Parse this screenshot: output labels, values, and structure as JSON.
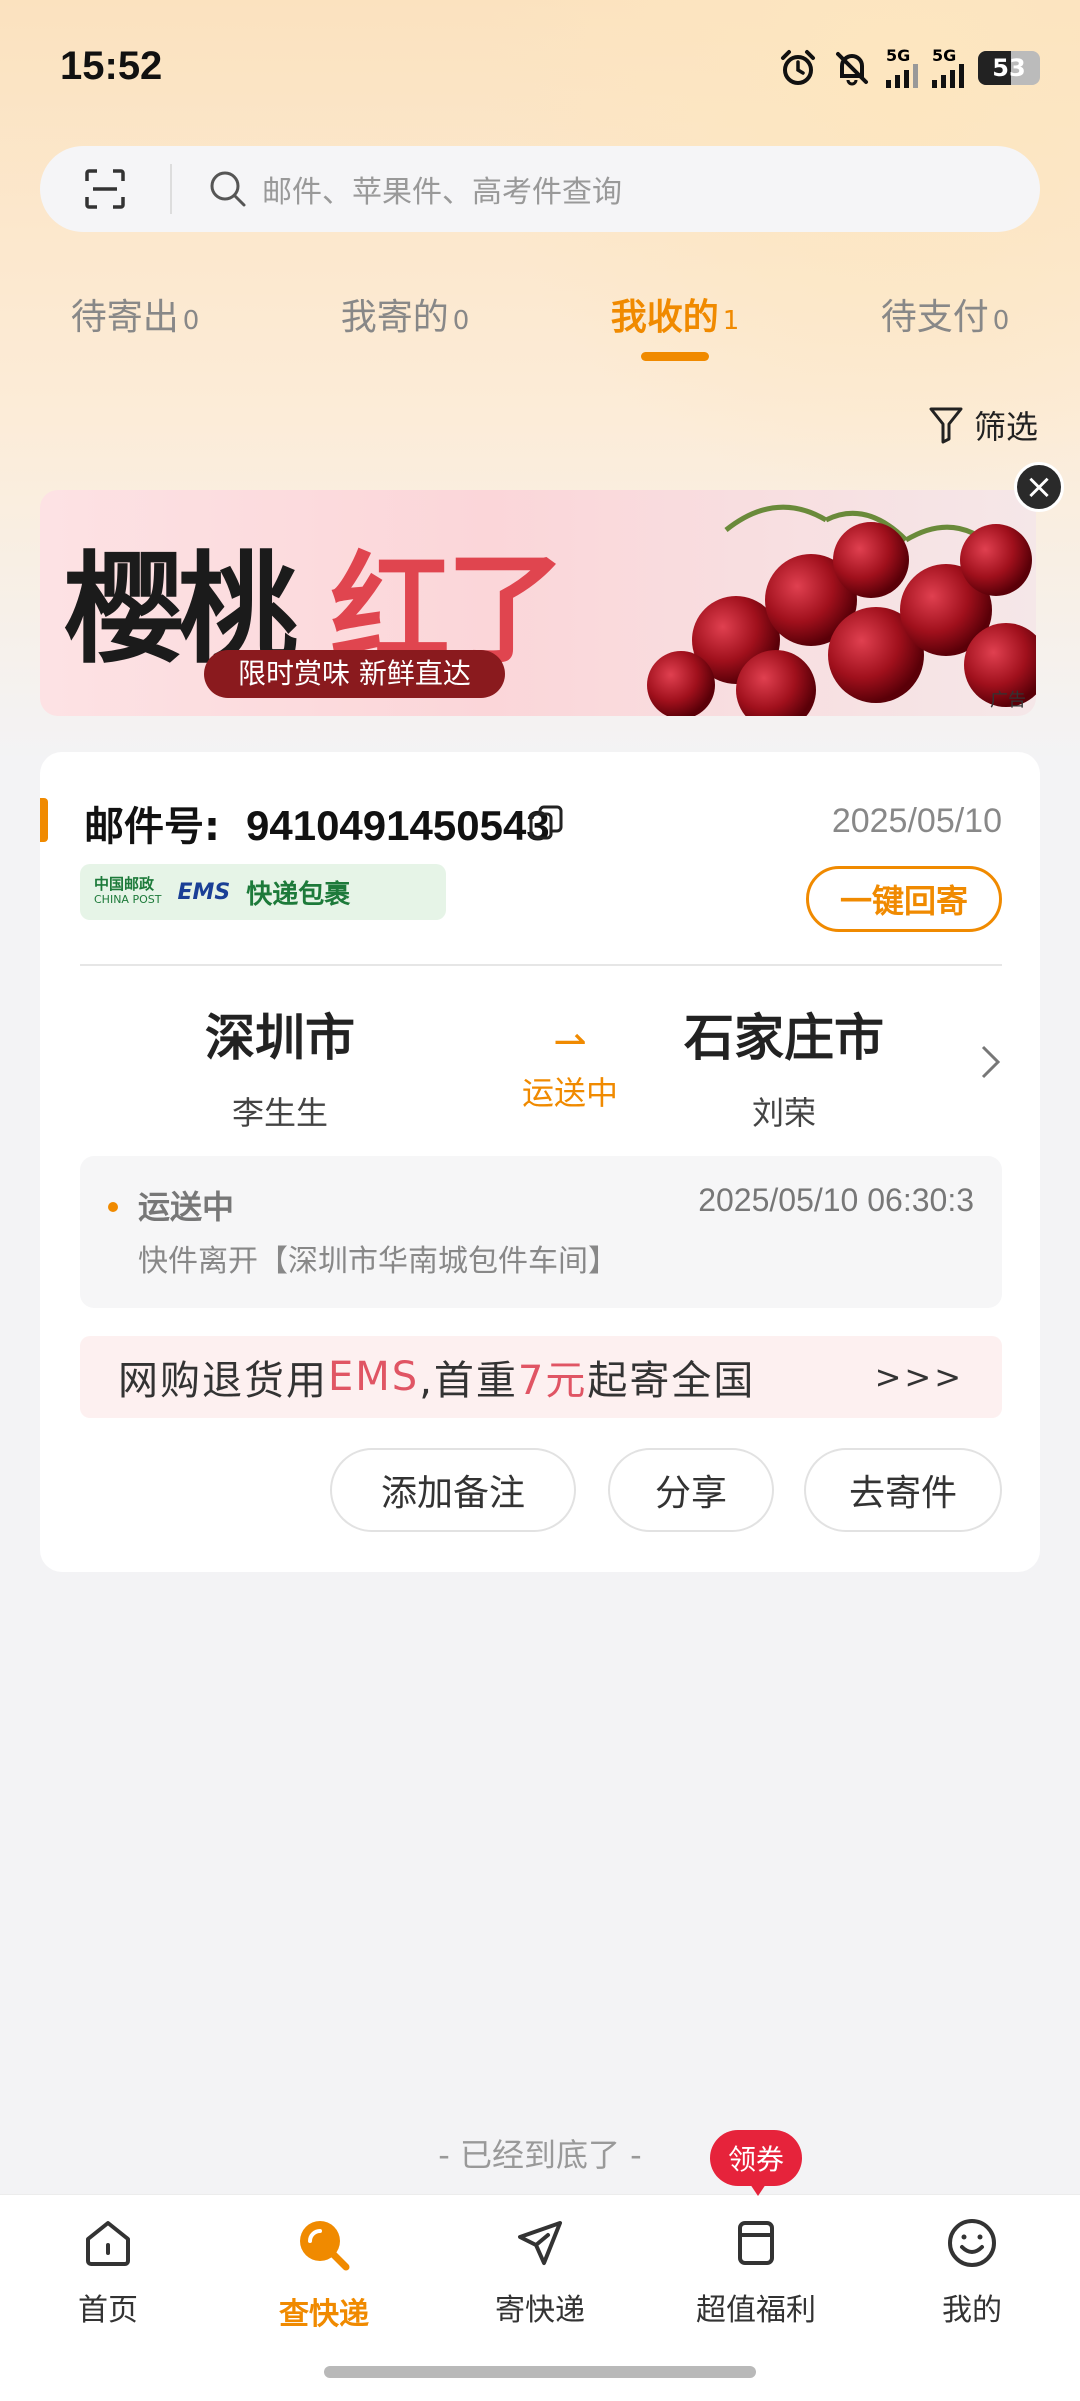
{
  "status_bar": {
    "time": "15:52",
    "battery": "53",
    "net1": "5G",
    "net2": "5G",
    "battery_level": 0.53
  },
  "search": {
    "placeholder": "邮件、苹果件、高考件查询"
  },
  "tabs": [
    {
      "label": "待寄出",
      "count": "0"
    },
    {
      "label": "我寄的",
      "count": "0"
    },
    {
      "label": "我收的",
      "count": "1",
      "active": true
    },
    {
      "label": "待支付",
      "count": "0"
    }
  ],
  "filter_label": "筛选",
  "banner": {
    "title_black": "樱桃",
    "title_red": "红了",
    "tagline": "限时赏味 新鲜直达",
    "ad_label": "广告"
  },
  "card": {
    "mail_label": "邮件号:",
    "mail_number": "9410491450543",
    "date": "2025/05/10",
    "carrier_cn": "中国邮政",
    "carrier_en": "CHINA POST",
    "carrier_ems": "EMS",
    "carrier_service": "快递包裹",
    "resend_label": "一键回寄",
    "from_city": "深圳市",
    "from_person": "李生生",
    "to_city": "石家庄市",
    "to_person": "刘荣",
    "transit_status": "运送中",
    "track_status": "运送中",
    "track_time": "2025/05/10 06:30:3",
    "track_detail": "快件离开【深圳市华南城包件车间】",
    "promo_a": "网购退货用",
    "promo_b": "EMS",
    "promo_c": ",首重",
    "promo_d": "7元",
    "promo_e": "起寄全国",
    "promo_more": ">>>",
    "btn_note": "添加备注",
    "btn_share": "分享",
    "btn_send": "去寄件"
  },
  "bottom_tip": "- 已经到底了 -",
  "coupon_badge": "领券",
  "nav": [
    {
      "label": "首页",
      "icon": "home-icon"
    },
    {
      "label": "查快递",
      "icon": "search-parcel-icon",
      "active": true
    },
    {
      "label": "寄快递",
      "icon": "send-icon"
    },
    {
      "label": "超值福利",
      "icon": "gift-bookmark-icon"
    },
    {
      "label": "我的",
      "icon": "smile-icon"
    }
  ],
  "colors": {
    "accent": "#f08a00",
    "promo_red": "#e05564",
    "badge_red": "#e6233b"
  }
}
